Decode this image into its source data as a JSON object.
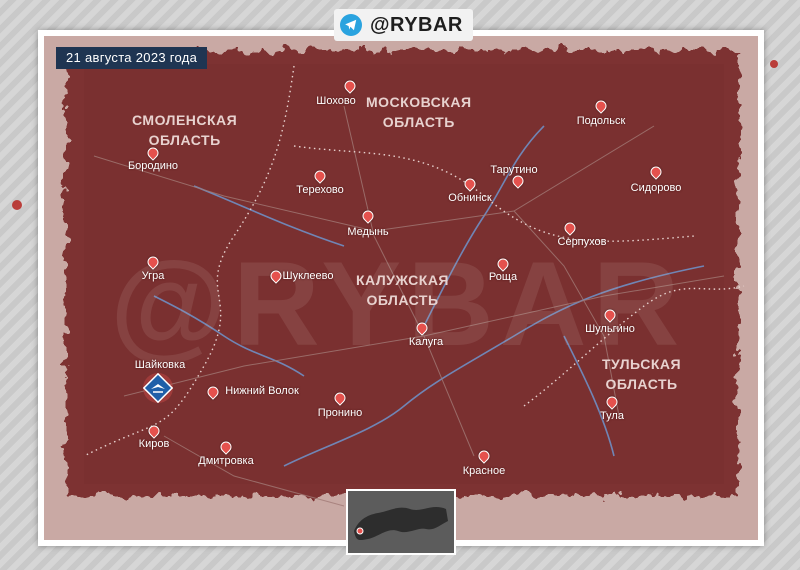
{
  "brand": {
    "name": "@RYBAR",
    "icon": "telegram-icon"
  },
  "date": "21 августа 2023 года",
  "watermark": "@RYBAR",
  "regions": [
    {
      "id": "smolensk",
      "lines": [
        "СМОЛЕНСКАЯ",
        "ОБЛАСТЬ"
      ]
    },
    {
      "id": "moscow",
      "lines": [
        "МОСКОВСКАЯ",
        "ОБЛАСТЬ"
      ]
    },
    {
      "id": "kaluga",
      "lines": [
        "КАЛУЖСКАЯ",
        "ОБЛАСТЬ"
      ]
    },
    {
      "id": "tula",
      "lines": [
        "ТУЛЬСКАЯ",
        "ОБЛАСТЬ"
      ]
    }
  ],
  "cities": [
    {
      "id": "shokhovo",
      "name": "Шохово"
    },
    {
      "id": "podolsk",
      "name": "Подольск"
    },
    {
      "id": "borodino",
      "name": "Бородино"
    },
    {
      "id": "tarutino",
      "name": "Тарутино"
    },
    {
      "id": "terekhovo",
      "name": "Терехово"
    },
    {
      "id": "obninsk",
      "name": "Обнинск"
    },
    {
      "id": "sidorovo",
      "name": "Сидорово"
    },
    {
      "id": "medyn",
      "name": "Медынь"
    },
    {
      "id": "serpukhov",
      "name": "Серпухов"
    },
    {
      "id": "ugra",
      "name": "Угра"
    },
    {
      "id": "shukleevo",
      "name": "Шуклеево"
    },
    {
      "id": "roshcha",
      "name": "Роща"
    },
    {
      "id": "kaluga",
      "name": "Калуга"
    },
    {
      "id": "shulgino",
      "name": "Шульгино"
    },
    {
      "id": "shaykovka",
      "name": "Шайковка"
    },
    {
      "id": "nizhniy-volok",
      "name": "Нижний Волок"
    },
    {
      "id": "pronino",
      "name": "Пронино"
    },
    {
      "id": "tula",
      "name": "Тула"
    },
    {
      "id": "kirov",
      "name": "Киров"
    },
    {
      "id": "dmitrovka",
      "name": "Дмитровка"
    },
    {
      "id": "krasnoe",
      "name": "Красное"
    }
  ],
  "colors": {
    "map_fill": "#7d3232",
    "accent": "#e5514d",
    "label_bg": "#1f3552",
    "military_marker": "#1f5fa8"
  }
}
